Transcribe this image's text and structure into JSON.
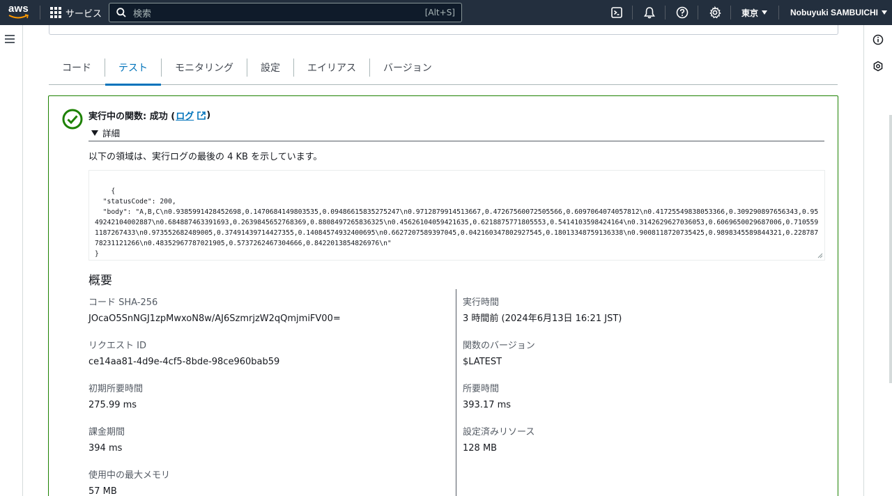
{
  "topnav": {
    "logo_text": "aws",
    "services_label": "サービス",
    "search_placeholder": "検索",
    "search_shortcut": "[Alt+S]",
    "region_label": "東京",
    "user_label": "Nobuyuki SAMBUICHI",
    "icons": [
      "cloudshell-icon",
      "notifications-bell-icon",
      "help-icon",
      "settings-gear-icon"
    ]
  },
  "tabs": [
    {
      "label": "コード",
      "active": false
    },
    {
      "label": "テスト",
      "active": true
    },
    {
      "label": "モニタリング",
      "active": false
    },
    {
      "label": "設定",
      "active": false
    },
    {
      "label": "エイリアス",
      "active": false
    },
    {
      "label": "バージョン",
      "active": false
    }
  ],
  "result": {
    "title_prefix": "実行中の関数: 成功 (",
    "log_link": "ログ",
    "title_suffix": ")",
    "details_label": "詳細",
    "log_intro": "以下の領域は、実行ログの最後の 4 KB を示しています。",
    "log_output": "{\n  \"statusCode\": 200,\n  \"body\": \"A,B,C\\n0.9385991428452698,0.1470684149803535,0.09486615835275247\\n0.9712879914513667,0.47267560072505566,0.6097064074057812\\n0.41725549838053366,0.309290897656343,0.9549242104002887\\n0.684887463391693,0.2639845652768369,0.8808497265836325\\n0.45626104059421635,0.6218875771805553,0.5414103598424164\\n0.3142629627036053,0.6069650029687006,0.7105591187267433\\n0.973552682489005,0.37491439714427355,0.14084574932400695\\n0.6627207589397045,0.042160347802927545,0.18013348759136338\\n0.9008118720735425,0.9898345589844321,0.22878778231121266\\n0.48352967787021905,0.5737262467304666,0.8422013854826976\\n\"\n}",
    "status_color": "#1d8102"
  },
  "summary": {
    "heading": "概要",
    "left": [
      {
        "label": "コード SHA-256",
        "value": "JOcaO5SnNGJ1zpMwxoN8w/AJ6SzmrjzW2qQmjmiFV00="
      },
      {
        "label": "リクエスト ID",
        "value": "ce14aa81-4d9e-4cf5-8bde-98ce960bab59"
      },
      {
        "label": "初期所要時間",
        "value": "275.99 ms"
      },
      {
        "label": "課金期間",
        "value": "394 ms"
      },
      {
        "label": "使用中の最大メモリ",
        "value": "57 MB"
      }
    ],
    "right": [
      {
        "label": "実行時間",
        "value": "3 時間前 (2024年6月13日 16:21 JST)"
      },
      {
        "label": "関数のバージョン",
        "value": "$LATEST"
      },
      {
        "label": "所要時間",
        "value": "393.17 ms"
      },
      {
        "label": "設定済みリソース",
        "value": "128 MB"
      }
    ]
  },
  "colors": {
    "nav_bg": "#232f3e",
    "accent": "#0073bb",
    "success": "#1d8102"
  }
}
